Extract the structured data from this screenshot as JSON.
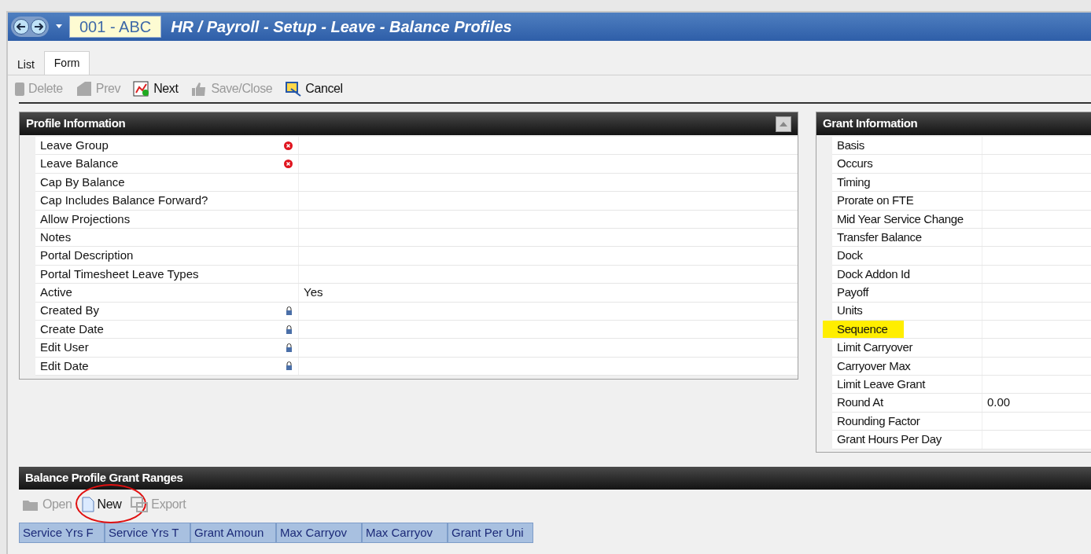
{
  "window": {
    "company": "001 - ABC",
    "title": "HR / Payroll - Setup - Leave - Balance Profiles"
  },
  "tabs": [
    {
      "label": "List",
      "selected": false
    },
    {
      "label": "Form",
      "selected": true
    }
  ],
  "toolbar": [
    {
      "label": "Delete",
      "kind": "delete",
      "disabled": true
    },
    {
      "label": "Prev",
      "kind": "prev",
      "disabled": true
    },
    {
      "label": "Next",
      "kind": "next",
      "disabled": false
    },
    {
      "label": "Save/Close",
      "kind": "save",
      "disabled": true
    },
    {
      "label": "Cancel",
      "kind": "cancel",
      "disabled": false
    }
  ],
  "profile_information": {
    "title": "Profile Information",
    "fields": [
      {
        "label": "Leave Group",
        "kind": "required"
      },
      {
        "label": "Leave Balance",
        "kind": "required"
      },
      {
        "label": "Cap By Balance",
        "kind": "plain"
      },
      {
        "label": "Cap Includes Balance Forward?",
        "kind": "plain"
      },
      {
        "label": "Allow Projections",
        "kind": "plain"
      },
      {
        "label": "Notes",
        "kind": "plain"
      },
      {
        "label": "Portal Description",
        "kind": "plain"
      },
      {
        "label": "Portal Timesheet Leave Types",
        "kind": "plain"
      },
      {
        "label": "Active",
        "value": "Yes",
        "kind": "plain"
      },
      {
        "label": "Created By",
        "kind": "locked"
      },
      {
        "label": "Create Date",
        "kind": "locked"
      },
      {
        "label": "Edit User",
        "kind": "locked"
      },
      {
        "label": "Edit Date",
        "kind": "locked"
      }
    ]
  },
  "grant_information": {
    "title": "Grant Information",
    "fields": [
      {
        "label": "Basis",
        "highlighted": false
      },
      {
        "label": "Occurs",
        "highlighted": false
      },
      {
        "label": "Timing",
        "highlighted": false
      },
      {
        "label": "Prorate on FTE",
        "highlighted": false
      },
      {
        "label": "Mid Year Service Change",
        "highlighted": false
      },
      {
        "label": "Transfer Balance",
        "highlighted": false
      },
      {
        "label": "Dock",
        "highlighted": false
      },
      {
        "label": "Dock Addon Id",
        "highlighted": false
      },
      {
        "label": "Payoff",
        "highlighted": false
      },
      {
        "label": "Units",
        "highlighted": false
      },
      {
        "label": "Sequence",
        "highlighted": true
      },
      {
        "label": "Limit Carryover",
        "highlighted": false
      },
      {
        "label": "Carryover Max",
        "highlighted": false
      },
      {
        "label": "Limit Leave Grant",
        "highlighted": false
      },
      {
        "label": "Round At",
        "value": "0.00",
        "highlighted": false
      },
      {
        "label": "Rounding Factor",
        "highlighted": false
      },
      {
        "label": "Grant Hours Per Day",
        "highlighted": false
      }
    ]
  },
  "grant_ranges": {
    "title": "Balance Profile Grant Ranges",
    "toolbar": [
      {
        "label": "Open",
        "kind": "open",
        "disabled": true,
        "circled": false
      },
      {
        "label": "New",
        "kind": "new",
        "disabled": false,
        "circled": true
      },
      {
        "label": "Export",
        "kind": "export",
        "disabled": true,
        "circled": false
      }
    ],
    "columns": [
      "Service Yrs F",
      "Service Yrs T",
      "Grant Amoun",
      "Max Carryov",
      "Max Carryov",
      "Grant Per Uni"
    ]
  }
}
